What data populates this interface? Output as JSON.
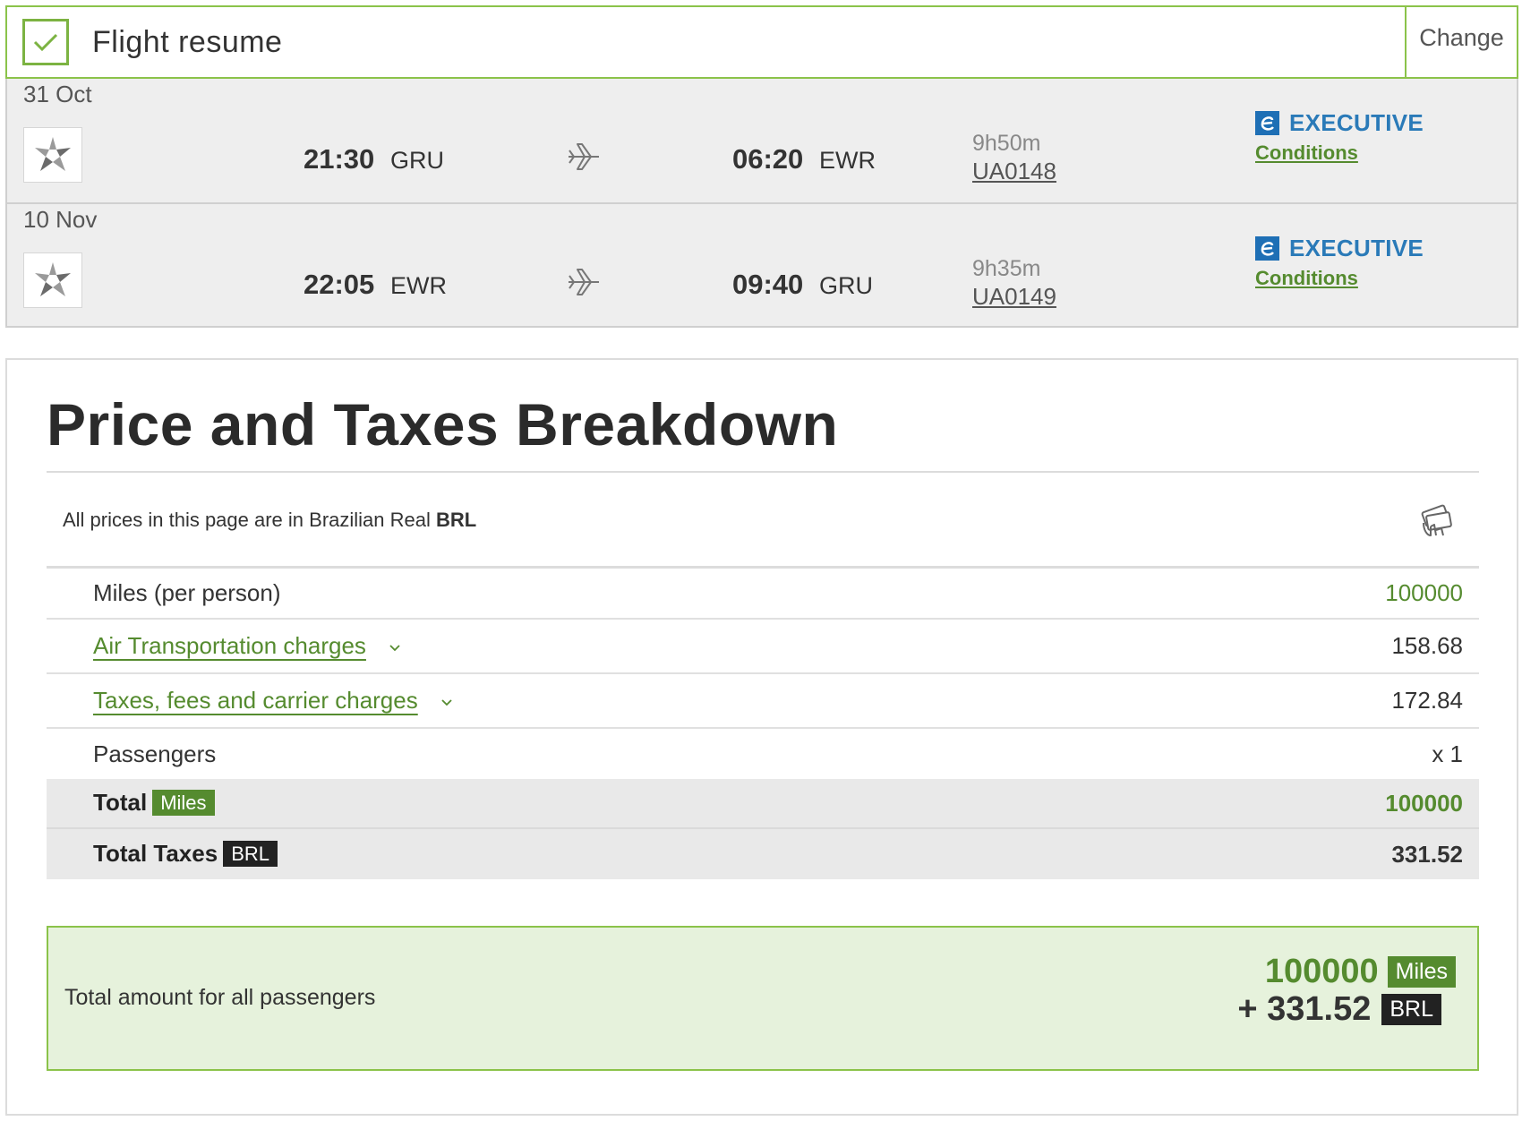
{
  "resume": {
    "title": "Flight resume",
    "change_label": "Change"
  },
  "segments": [
    {
      "date": "31 Oct",
      "dep_time": "21:30",
      "dep_code": "GRU",
      "arr_time": "06:20",
      "arr_code": "EWR",
      "duration": "9h50m",
      "flight_no": "UA0148",
      "cabin": "EXECUTIVE",
      "conditions": "Conditions"
    },
    {
      "date": "10 Nov",
      "dep_time": "22:05",
      "dep_code": "EWR",
      "arr_time": "09:40",
      "arr_code": "GRU",
      "duration": "9h35m",
      "flight_no": "UA0149",
      "cabin": "EXECUTIVE",
      "conditions": "Conditions"
    }
  ],
  "price": {
    "title": "Price and Taxes Breakdown",
    "currency_note_prefix": "All prices in this page are in Brazilian Real ",
    "currency_code": "BRL",
    "rows": {
      "miles": {
        "label": "Miles (per person)",
        "value": "100000"
      },
      "air": {
        "label": "Air Transportation charges",
        "value": "158.68"
      },
      "taxes": {
        "label": "Taxes, fees and carrier charges",
        "value": "172.84"
      },
      "passengers": {
        "label": "Passengers",
        "value": "x 1"
      }
    },
    "totals": {
      "miles_label": "Total",
      "miles_tag": "Miles",
      "miles_value": "100000",
      "taxes_label": "Total Taxes",
      "taxes_tag": "BRL",
      "taxes_value": "331.52"
    },
    "grand": {
      "label": "Total amount for all passengers",
      "miles": "100000",
      "miles_tag": "Miles",
      "brl": "+ 331.52",
      "brl_tag": "BRL"
    }
  },
  "colors": {
    "accent_green": "#558b2f",
    "border_green": "#8bc34a",
    "cabin_blue": "#2a7ab8"
  }
}
